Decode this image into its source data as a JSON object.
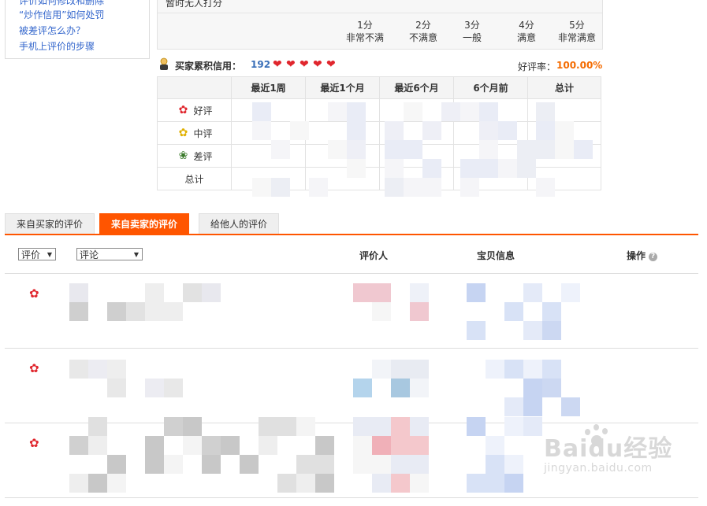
{
  "help_links": [
    "评价如何修改和删除",
    "“炒作信用”如何处罚",
    "被差评怎么办？",
    "手机上评价的步骤"
  ],
  "rating": {
    "no_rating_text": "暂时无人打分",
    "scores": [
      {
        "score": "1分",
        "desc": "非常不满"
      },
      {
        "score": "2分",
        "desc": "不满意"
      },
      {
        "score": "3分",
        "desc": "一般"
      },
      {
        "score": "4分",
        "desc": "满意"
      },
      {
        "score": "5分",
        "desc": "非常满意"
      }
    ]
  },
  "credit": {
    "label": "买家累积信用：",
    "points": "192",
    "hearts": 5,
    "rate_label": "好评率：",
    "rate_value": "100.00%"
  },
  "credit_table": {
    "headers": [
      "",
      "最近1周",
      "最近1个月",
      "最近6个月",
      "6个月前",
      "总计"
    ],
    "rows": [
      {
        "label": "好评",
        "icon": "red-flower-icon"
      },
      {
        "label": "中评",
        "icon": "yellow-flower-icon"
      },
      {
        "label": "差评",
        "icon": "wilted-flower-icon"
      },
      {
        "label": "总计",
        "icon": ""
      }
    ]
  },
  "tabs": [
    {
      "label": "来自买家的评价",
      "active": false
    },
    {
      "label": "来自卖家的评价",
      "active": true
    },
    {
      "label": "给他人的评价",
      "active": false
    }
  ],
  "filters": {
    "rating_select": "评价",
    "comment_select": "评论"
  },
  "columns": {
    "reviewer": "评价人",
    "item_info": "宝贝信息",
    "action": "操作"
  },
  "watermark": {
    "brand": "Baidu经验",
    "url": "jingyan.baidu.com"
  },
  "colors": {
    "accent": "#ff5500",
    "link": "#3366cc",
    "rate": "#f46b00",
    "heart": "#e0262d"
  }
}
